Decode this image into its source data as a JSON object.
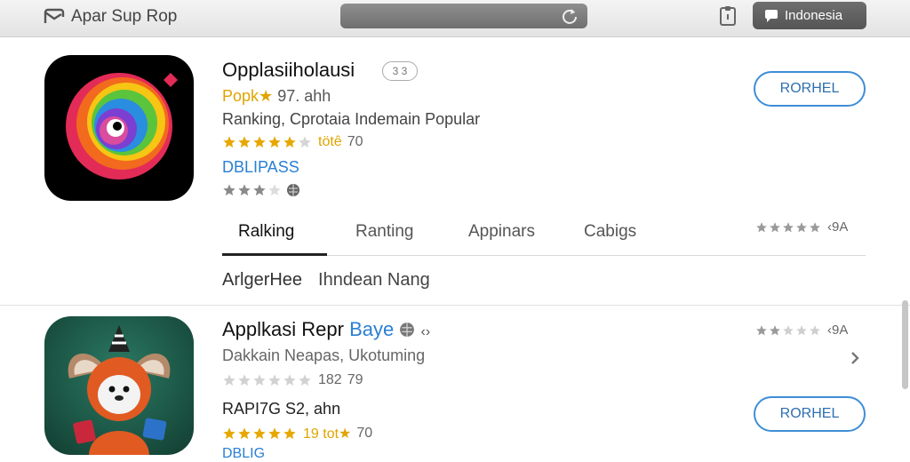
{
  "header": {
    "app_title": "Apar Sup Rop",
    "region_label": "Indonesia"
  },
  "apps": [
    {
      "title": "Opplasiiholausi",
      "version_badge": "3 3",
      "subtitle_gold": "Popk★",
      "subtitle_rest": "97. ahh",
      "category_line": "Ranking, Cprotaia Indemain Popular",
      "rating_text_gold": "tötê",
      "rating_count": "70",
      "link_label": "DBLIPASS",
      "get_label": "RORHEL"
    },
    {
      "title_main": "Applkasi Repr",
      "title_blue": "Baye",
      "arrows": "‹›",
      "subtitle": "Dakkain Neapas, Ukotuming",
      "gray_rating_text": "182",
      "gray_rating_count": "79",
      "price_line": "RAPI7G S2, ahn",
      "gold_rating_text": "19 tot★",
      "gold_rating_count": "70",
      "link_label": "DBLIG",
      "get_label": "RORHEL",
      "right_rating": "‹9A"
    }
  ],
  "tabs": [
    "Ralking",
    "Ranting",
    "Appinars",
    "Cabigs"
  ],
  "tab_right_rating": "‹9A",
  "section_label": {
    "part1": "ArlgerHee",
    "part2": "Ihndean Nang"
  },
  "colors": {
    "accent_blue": "#2a7fd4",
    "star_gold": "#e6a800",
    "star_gray": "#9a9a9a"
  },
  "icons": [
    "mail-icon",
    "reload-icon",
    "clipboard-icon",
    "speech-bubble-icon",
    "globe-icon",
    "chevron-right-icon",
    "star-icon"
  ]
}
